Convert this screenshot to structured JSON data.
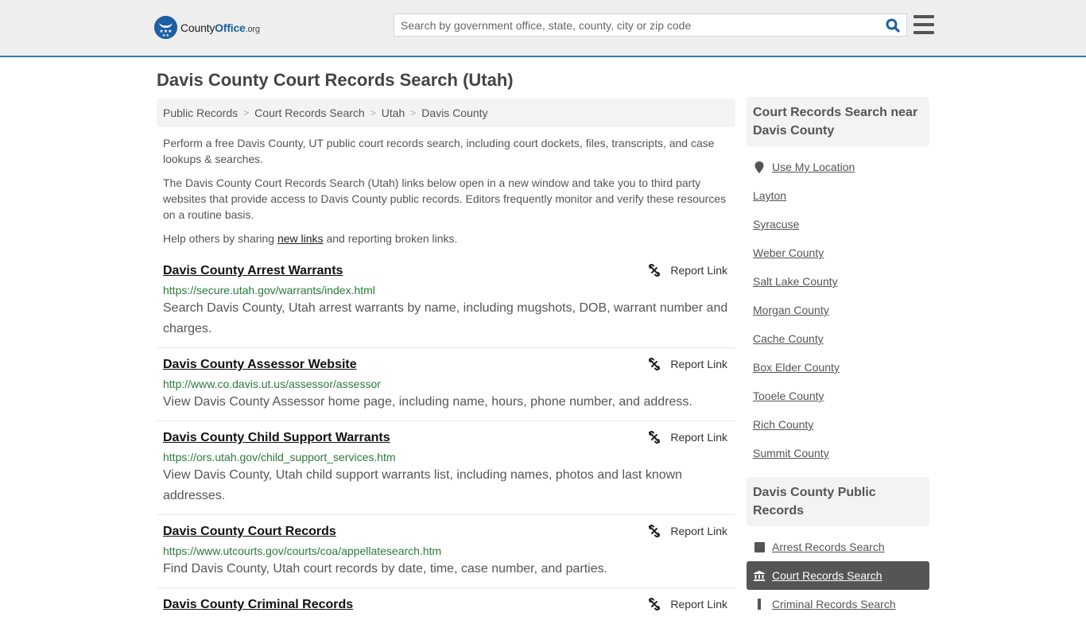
{
  "header": {
    "logo": {
      "county": "County",
      "office": "Office",
      "org": ".org"
    },
    "search_placeholder": "Search by government office, state, county, city or zip code",
    "brand_color": "#1d5fa3",
    "accent_border_color": "#3a7bab"
  },
  "page": {
    "title": "Davis County Court Records Search (Utah)"
  },
  "breadcrumb": [
    {
      "label": "Public Records"
    },
    {
      "label": "Court Records Search"
    },
    {
      "label": "Utah"
    },
    {
      "label": "Davis County"
    }
  ],
  "intro": {
    "p1": "Perform a free Davis County, UT public court records search, including court dockets, files, transcripts, and case lookups & searches.",
    "p2": "The Davis County Court Records Search (Utah) links below open in a new window and take you to third party websites that provide access to Davis County public records. Editors frequently monitor and verify these resources on a routine basis.",
    "p3_before": "Help others by sharing ",
    "p3_link": "new links",
    "p3_after": " and reporting broken links."
  },
  "results": [
    {
      "title": "Davis County Arrest Warrants",
      "url": "https://secure.utah.gov/warrants/index.html",
      "description": "Search Davis County, Utah arrest warrants by name, including mugshots, DOB, warrant number and charges.",
      "report_label": "Report Link"
    },
    {
      "title": "Davis County Assessor Website",
      "url": "http://www.co.davis.ut.us/assessor/assessor",
      "description": "View Davis County Assessor home page, including name, hours, phone number, and address.",
      "report_label": "Report Link"
    },
    {
      "title": "Davis County Child Support Warrants",
      "url": "https://ors.utah.gov/child_support_services.htm",
      "description": "View Davis County, Utah child support warrants list, including names, photos and last known addresses.",
      "report_label": "Report Link"
    },
    {
      "title": "Davis County Court Records",
      "url": "https://www.utcourts.gov/courts/coa/appellatesearch.htm",
      "description": "Find Davis County, Utah court records by date, time, case number, and parties.",
      "report_label": "Report Link"
    },
    {
      "title": "Davis County Criminal Records",
      "url": "",
      "description": "",
      "report_label": "Report Link"
    }
  ],
  "sidebar": {
    "nearby": {
      "heading": "Court Records Search near Davis County",
      "use_location": "Use My Location",
      "items": [
        "Layton",
        "Syracuse",
        "Weber County",
        "Salt Lake County",
        "Morgan County",
        "Cache County",
        "Box Elder County",
        "Tooele County",
        "Rich County",
        "Summit County"
      ]
    },
    "public_records": {
      "heading": "Davis County Public Records",
      "items": [
        {
          "label": "Arrest Records Search",
          "icon": "square-icon",
          "active": false
        },
        {
          "label": "Court Records Search",
          "icon": "courthouse-icon",
          "active": true
        },
        {
          "label": "Criminal Records Search",
          "icon": "bar-icon",
          "active": false
        }
      ]
    }
  }
}
